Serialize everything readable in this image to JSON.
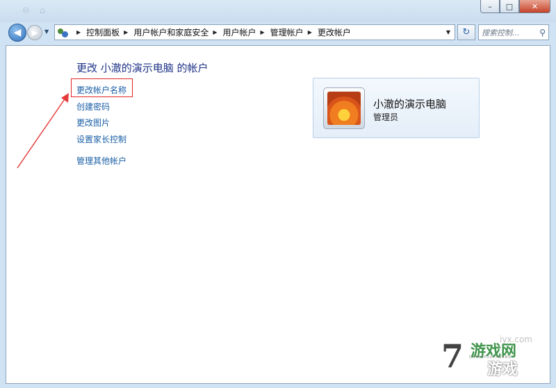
{
  "window": {
    "minimize_glyph": "–",
    "maximize_glyph": "□",
    "close_glyph": "✕"
  },
  "nav": {
    "back_glyph": "◀",
    "forward_glyph": "▶"
  },
  "address": {
    "breadcrumbs": [
      "控制面板",
      "用户帐户和家庭安全",
      "用户帐户",
      "管理帐户",
      "更改帐户"
    ],
    "refresh_glyph": "↻"
  },
  "search": {
    "placeholder": "搜索控制..."
  },
  "main": {
    "title": "更改 小澈的演示电脑 的帐户",
    "tasks": [
      "更改帐户名称",
      "创建密码",
      "更改图片",
      "设置家长控制"
    ],
    "other_link": "管理其他帐户"
  },
  "user": {
    "name": "小澈的演示电脑",
    "role": "管理员"
  },
  "watermark": {
    "number": "7",
    "top_text": "游戏网",
    "bottom_text": "游戏",
    "url": "iyx.com",
    "pinyin": "QIHAOYOUXIWANG"
  },
  "colors": {
    "link": "#1a5fa6",
    "title": "#1e3287",
    "highlight": "#e32424"
  }
}
